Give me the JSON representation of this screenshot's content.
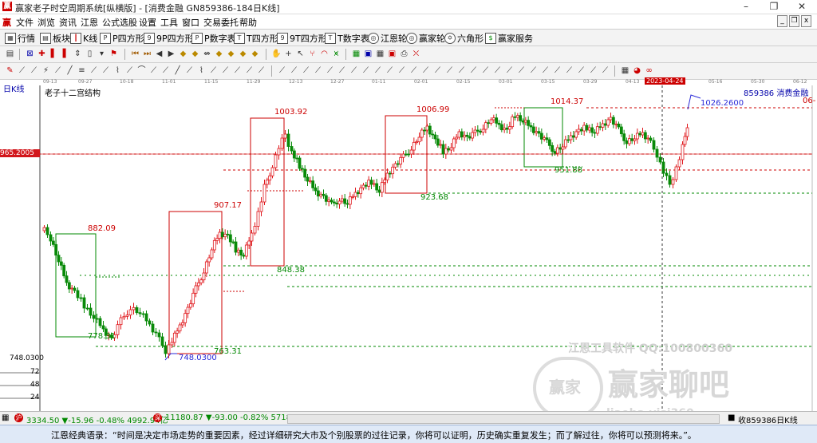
{
  "window": {
    "title": "赢家老子时空周期系统[纵横版] - [消费金融  GN859386-184日K线]",
    "controls": [
      "–",
      "❐",
      "✕"
    ]
  },
  "menu": {
    "items": [
      "文件",
      "浏览",
      "资讯",
      "江恩",
      "公式选股",
      "设置",
      "工具",
      "窗口",
      "交易委托",
      "帮助"
    ],
    "mdi_controls": [
      "_",
      "❐",
      "x"
    ]
  },
  "toolbar": {
    "items": [
      "行情",
      "板块",
      "K线",
      "P四方形",
      "9P四方形",
      "P数字表",
      "T四方形",
      "9T四方形",
      "T数字表",
      "江恩轮",
      "赢家轮",
      "六角形",
      "赢家服务"
    ]
  },
  "date_axis": [
    "09-13",
    "09-27",
    "10-18",
    "11-01",
    "11-15",
    "11-29",
    "12-13",
    "12-27",
    "01-11",
    "02-01",
    "02-15",
    "03-01",
    "03-15",
    "03-29",
    "04-13",
    "2023-04-24",
    "05-16",
    "05-30",
    "06-12"
  ],
  "chart": {
    "period_label": "日K线",
    "indicator_label": "老子十二宫结构",
    "symbol_label": "859386  消费金融",
    "right_edge_label": "06-",
    "current_price_tag": "965.2005",
    "low_scale_label": "748.0300",
    "price_annotations": [
      "882.09",
      "778.31",
      "748.0300",
      "763.31",
      "907.17",
      "1003.92",
      "848.38",
      "1006.99",
      "923.68",
      "1014.37",
      "951.88",
      "1026.2600"
    ],
    "y_axis_labels": [
      "72",
      "48",
      "24"
    ]
  },
  "watermark": {
    "tool_text": "江恩工具软件 QQ:100800360",
    "brand_text": "赢家聊吧",
    "seal_text": "赢家",
    "url_text": "liaoba.yjsj360"
  },
  "statusbar": {
    "index1": "3334.50 ▼-15.96 -0.48% 4992.94亿",
    "index2": "11180.87 ▼-93.00 -0.82% 5718.88",
    "right_text": "收859386日K线"
  },
  "quote": {
    "text": "江恩经典语录：“时间是决定市场走势的重要因素，经过详细研究大市及个别股票的过往记录，你将可以证明，历史确实重复发生；而了解过往，你将可以预测将来。”。"
  },
  "colors": {
    "up": "#e0161b",
    "down": "#098a09",
    "price_tag": "#d2161b",
    "blue_label": "#2a2ad8"
  }
}
